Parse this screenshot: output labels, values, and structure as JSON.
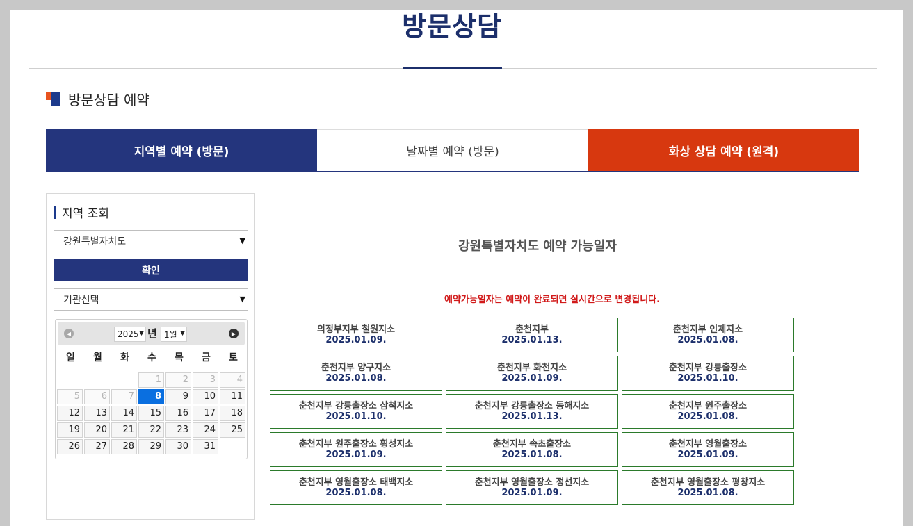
{
  "page": {
    "title": "방문상담"
  },
  "section": {
    "title": "방문상담 예약"
  },
  "colors": {
    "navy": "#24357d",
    "orange": "#d7380f",
    "green_border": "#2b7a2b",
    "notice_red": "#d11a1a",
    "today_blue": "#0a6fe0"
  },
  "tabs": [
    {
      "label": "지역별 예약 (방문)",
      "active": true
    },
    {
      "label": "날짜별 예약 (방문)",
      "active": false
    },
    {
      "label": "화상 상담 예약 (원격)",
      "active": false
    }
  ],
  "sidebar": {
    "heading": "지역 조회",
    "region_select": "강원특별자치도",
    "confirm_label": "확인",
    "org_select": "기관선택",
    "calendar": {
      "year": "2025",
      "year_suffix": "년",
      "month": "1월",
      "weekdays": [
        "일",
        "월",
        "화",
        "수",
        "목",
        "금",
        "토"
      ],
      "weeks": [
        [
          "",
          "",
          "",
          "1",
          "2",
          "3",
          "4"
        ],
        [
          "5",
          "6",
          "7",
          "8",
          "9",
          "10",
          "11"
        ],
        [
          "12",
          "13",
          "14",
          "15",
          "16",
          "17",
          "18"
        ],
        [
          "19",
          "20",
          "21",
          "22",
          "23",
          "24",
          "25"
        ],
        [
          "26",
          "27",
          "28",
          "29",
          "30",
          "31",
          ""
        ]
      ],
      "muted_days": [
        "1",
        "2",
        "3",
        "4",
        "5",
        "6",
        "7"
      ],
      "today": "8"
    }
  },
  "main": {
    "availability_title": "강원특별자치도 예약 가능일자",
    "notice": "예약가능일자는 예약이 완료되면 실시간으로 변경됩니다.",
    "branches": [
      {
        "name": "의정부지부 철원지소",
        "date": "2025.01.09."
      },
      {
        "name": "춘천지부",
        "date": "2025.01.13."
      },
      {
        "name": "춘천지부 인제지소",
        "date": "2025.01.08."
      },
      {
        "name": "춘천지부 양구지소",
        "date": "2025.01.08."
      },
      {
        "name": "춘천지부 화천지소",
        "date": "2025.01.09."
      },
      {
        "name": "춘천지부 강릉출장소",
        "date": "2025.01.10."
      },
      {
        "name": "춘천지부 강릉출장소 삼척지소",
        "date": "2025.01.10."
      },
      {
        "name": "춘천지부 강릉출장소 동해지소",
        "date": "2025.01.13."
      },
      {
        "name": "춘천지부 원주출장소",
        "date": "2025.01.08."
      },
      {
        "name": "춘천지부 원주출장소 횡성지소",
        "date": "2025.01.09."
      },
      {
        "name": "춘천지부 속초출장소",
        "date": "2025.01.08."
      },
      {
        "name": "춘천지부 영월출장소",
        "date": "2025.01.09."
      },
      {
        "name": "춘천지부 영월출장소 태백지소",
        "date": "2025.01.08."
      },
      {
        "name": "춘천지부 영월출장소 정선지소",
        "date": "2025.01.09."
      },
      {
        "name": "춘천지부 영월출장소 평창지소",
        "date": "2025.01.08."
      }
    ]
  }
}
